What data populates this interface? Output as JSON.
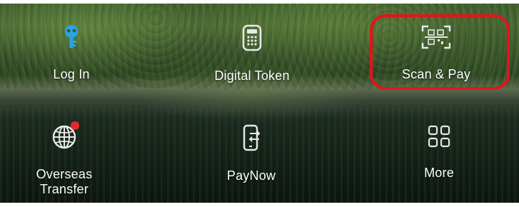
{
  "menu": {
    "row1": {
      "login": {
        "label": "Log In",
        "icon": "key-icon"
      },
      "digital_token": {
        "label": "Digital Token",
        "icon": "token-device-icon"
      },
      "scan_pay": {
        "label": "Scan & Pay",
        "icon": "qr-scan-icon"
      }
    },
    "row2": {
      "overseas": {
        "label": "Overseas\nTransfer",
        "icon": "globe-icon",
        "has_notification_dot": true
      },
      "paynow": {
        "label": "PayNow",
        "icon": "phone-transfer-icon"
      },
      "more": {
        "label": "More",
        "icon": "grid-icon"
      }
    }
  },
  "colors": {
    "highlight_outline": "#e3141b",
    "login_icon": "#2aa4e6",
    "notification_dot": "#e8262d",
    "label_text": "#ffffff"
  }
}
